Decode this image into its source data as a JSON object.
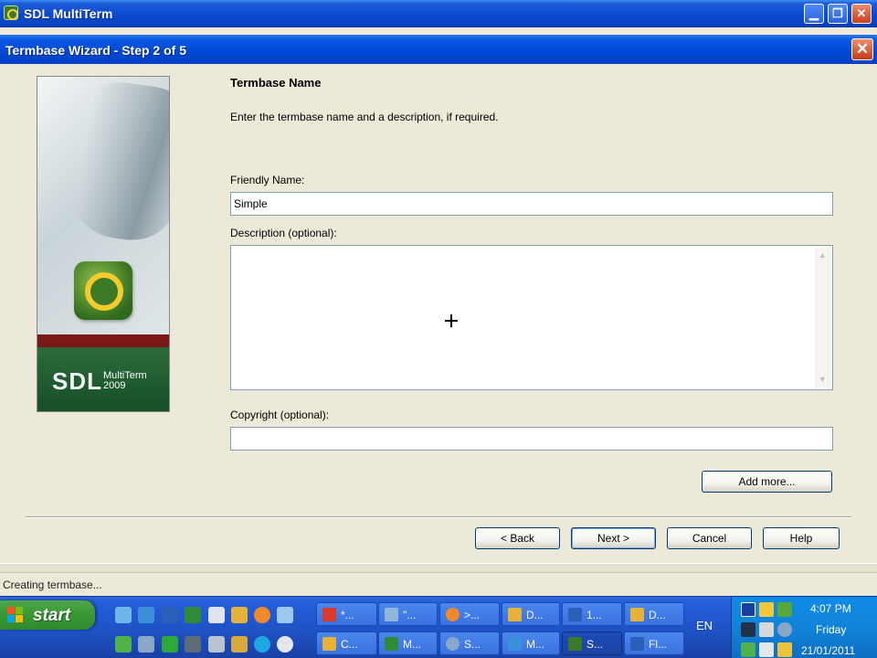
{
  "app": {
    "title": "SDL MultiTerm"
  },
  "dialog": {
    "title": "Termbase Wizard - Step 2 of 5",
    "close_glyph": "✕",
    "side_logo": {
      "brand": "SDL",
      "product_line1": "MultiTerm",
      "product_line2": "2009"
    },
    "section_title": "Termbase Name",
    "instructions": "Enter the termbase name and a description, if required.",
    "friendly_name": {
      "label": "Friendly Name:",
      "value": "Simple"
    },
    "description": {
      "label": "Description (optional):",
      "value": ""
    },
    "copyright": {
      "label": "Copyright (optional):",
      "value": ""
    },
    "buttons": {
      "add_more": "Add more...",
      "back": "< Back",
      "next": "Next >",
      "cancel": "Cancel",
      "help": "Help"
    }
  },
  "status_bar": {
    "text": "Creating termbase..."
  },
  "taskbar": {
    "start_label": "start",
    "tasks": [
      {
        "label": "*...",
        "icon": "image-editor-icon"
      },
      {
        "label": "\"...",
        "icon": "network-icon"
      },
      {
        "label": ">...",
        "icon": "firefox-icon"
      },
      {
        "label": "D...",
        "icon": "folder-icon"
      },
      {
        "label": "1...",
        "icon": "word-icon"
      },
      {
        "label": "D...",
        "icon": "folder-icon"
      },
      {
        "label": "C...",
        "icon": "folder-icon"
      },
      {
        "label": "M...",
        "icon": "excel-icon"
      },
      {
        "label": "S...",
        "icon": "globe-icon"
      },
      {
        "label": "M...",
        "icon": "ie-icon"
      },
      {
        "label": "S...",
        "icon": "multiterm-icon"
      },
      {
        "label": "Fl...",
        "icon": "app-icon"
      }
    ],
    "language": "EN",
    "clock": {
      "time": "4:07 PM",
      "day": "Friday",
      "date": "21/01/2011"
    }
  },
  "colors": {
    "title_blue": "#0a4bd0",
    "start_green": "#3c9a38",
    "close_red": "#c9401c",
    "tray_blue": "#1184d9"
  }
}
